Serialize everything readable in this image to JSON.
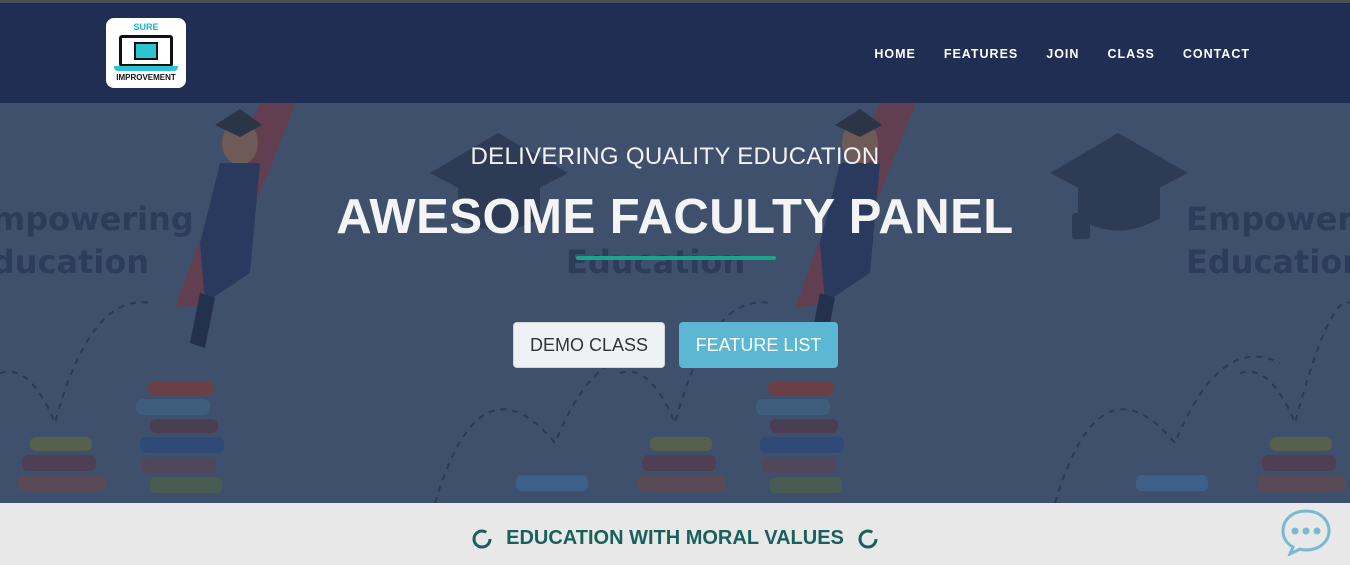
{
  "header": {
    "logo": {
      "top_text": "SURE",
      "bottom_text": "IMPROVEMENT"
    },
    "nav": [
      "HOME",
      "FEATURES",
      "JOIN",
      "CLASS",
      "CONTACT"
    ]
  },
  "hero": {
    "subtitle": "DELIVERING QUALITY EDUCATION",
    "title": "AWESOME FACULTY PANEL",
    "background_text_line1": "Empowering",
    "background_text_line2": "Education",
    "buttons": {
      "demo": "DEMO CLASS",
      "feature": "FEATURE LIST"
    }
  },
  "strip": {
    "text": "EDUCATION WITH MORAL VALUES"
  },
  "icons": {
    "chat": "chat-bubble-icon",
    "ring": "spinner-ring-icon"
  },
  "colors": {
    "header_bg": "#1f2e52",
    "hero_overlay": "#3f506d",
    "accent_teal": "#1ba38e",
    "feature_button": "#5bb7d3",
    "strip_text": "#17605e"
  }
}
